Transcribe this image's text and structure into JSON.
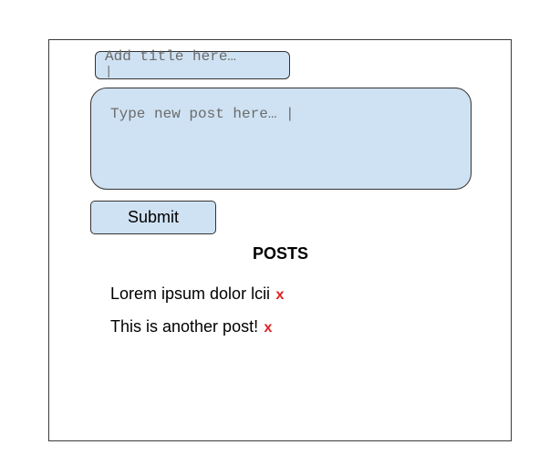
{
  "form": {
    "title_placeholder": "Add title here…",
    "title_cursor": "|",
    "post_placeholder": "Type new post here… |",
    "submit_label": "Submit"
  },
  "posts": {
    "heading": "POSTS",
    "items": [
      {
        "text": "Lorem ipsum dolor lcii",
        "delete_label": "x"
      },
      {
        "text": "This is another post!",
        "delete_label": "x"
      }
    ]
  },
  "colors": {
    "input_background": "#cfe2f3",
    "delete_color": "#e02020"
  }
}
